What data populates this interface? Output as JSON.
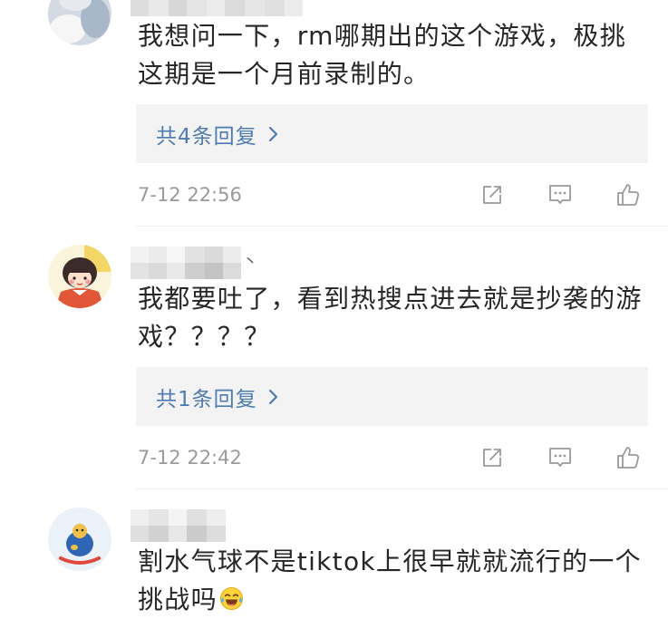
{
  "comments": [
    {
      "text_lines": [
        "我想问一下，rm哪期出的这个游戏，极挑",
        "这期是一个月前录制的。"
      ],
      "reply_link": "共4条回复",
      "timestamp": "7-12 22:56"
    },
    {
      "username_tail": "丶",
      "text_lines": [
        "我都要吐了，看到热搜点进去就是抄袭的游",
        "戏？？？？"
      ],
      "reply_link": "共1条回复",
      "timestamp": "7-12 22:42"
    },
    {
      "text_lines": [
        "割水气球不是tiktok上很早就就流行的一个",
        "挑战吗"
      ],
      "inline_emoji": "laugh-cry-emoji-icon"
    }
  ],
  "icons": {
    "share": "share-icon",
    "comment": "comment-icon",
    "like": "like-icon",
    "replies_arrow": "chevron-right-icon"
  },
  "colors": {
    "text": "#262626",
    "link": "#4f7cb0",
    "meta": "#9a9a9a",
    "reply_bg": "#f3f3f3",
    "icon": "#9a9a9a"
  }
}
